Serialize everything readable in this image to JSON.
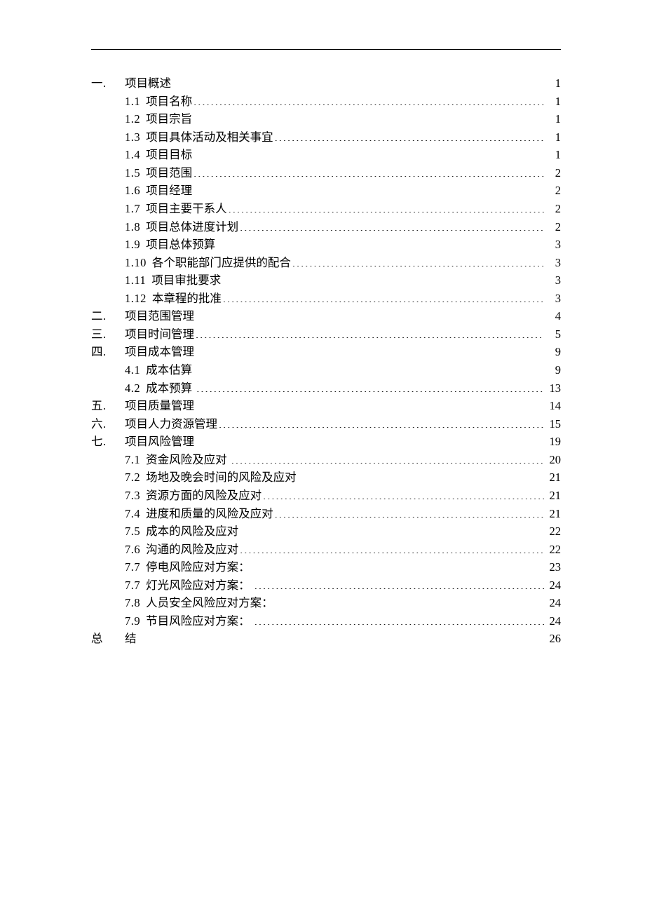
{
  "toc": [
    {
      "level": 1,
      "num": "一.",
      "title": "项目概述",
      "page": "1"
    },
    {
      "level": 2,
      "num": "1.1",
      "title": "项目名称",
      "page": "1"
    },
    {
      "level": 2,
      "num": "1.2",
      "title": "项目宗旨",
      "page": "1"
    },
    {
      "level": 2,
      "num": "1.3",
      "title": "项目具体活动及相关事宜",
      "page": "1"
    },
    {
      "level": 2,
      "num": "1.4",
      "title": "项目目标",
      "page": "1"
    },
    {
      "level": 2,
      "num": "1.5",
      "title": "项目范围",
      "page": "2"
    },
    {
      "level": 2,
      "num": "1.6",
      "title": "项目经理",
      "page": "2"
    },
    {
      "level": 2,
      "num": "1.7",
      "title": "项目主要干系人",
      "page": "2"
    },
    {
      "level": 2,
      "num": "1.8",
      "title": "项目总体进度计划",
      "page": "2"
    },
    {
      "level": 2,
      "num": "1.9",
      "title": "项目总体预算",
      "page": "3"
    },
    {
      "level": 2,
      "num": "1.10",
      "title": "各个职能部门应提供的配合",
      "page": "3"
    },
    {
      "level": 2,
      "num": "1.11",
      "title": "项目审批要求",
      "page": "3"
    },
    {
      "level": 2,
      "num": "1.12",
      "title": "本章程的批准",
      "page": "3"
    },
    {
      "level": 1,
      "num": "二.",
      "title": "项目范围管理",
      "page": "4"
    },
    {
      "level": 1,
      "num": "三.",
      "title": "项目时间管理",
      "page": "5"
    },
    {
      "level": 1,
      "num": "四.",
      "title": "项目成本管理",
      "page": "9"
    },
    {
      "level": 2,
      "num": "4.1",
      "title": "成本估算",
      "page": "9",
      "trail_space": true
    },
    {
      "level": 2,
      "num": "4.2",
      "title": "成本预算",
      "page": "13",
      "trail_space": true
    },
    {
      "level": 1,
      "num": "五.",
      "title": "项目质量管理",
      "page": "14"
    },
    {
      "level": 1,
      "num": "六.",
      "title": "项目人力资源管理",
      "page": "15"
    },
    {
      "level": 1,
      "num": "七.",
      "title": "项目风险管理",
      "page": "19"
    },
    {
      "level": 2,
      "num": "7.1",
      "title": "资金风险及应对",
      "page": "20",
      "trail_space": true
    },
    {
      "level": 2,
      "num": "7.2",
      "title": "场地及晚会时间的风险及应对",
      "page": "21"
    },
    {
      "level": 2,
      "num": "7.3",
      "title": "资源方面的风险及应对",
      "page": "21"
    },
    {
      "level": 2,
      "num": "7.4",
      "title": "进度和质量的风险及应对",
      "page": "21"
    },
    {
      "level": 2,
      "num": "7.5",
      "title": "成本的风险及应对",
      "page": "22"
    },
    {
      "level": 2,
      "num": "7.6",
      "title": "沟通的风险及应对",
      "page": "22"
    },
    {
      "level": 2,
      "num": "7.7",
      "title": "停电风险应对方案：",
      "page": "23",
      "trail_space": true
    },
    {
      "level": 2,
      "num": "7.7",
      "title": "灯光风险应对方案：",
      "page": "24",
      "trail_space": true
    },
    {
      "level": 2,
      "num": "7.8",
      "title": "人员安全风险应对方案：",
      "page": "24",
      "trail_space": true
    },
    {
      "level": 2,
      "num": "7.9",
      "title": "节目风险应对方案：",
      "page": "24",
      "trail_space": true
    },
    {
      "level": 1,
      "num": "总",
      "title": "结",
      "page": "26",
      "summary": true
    }
  ]
}
